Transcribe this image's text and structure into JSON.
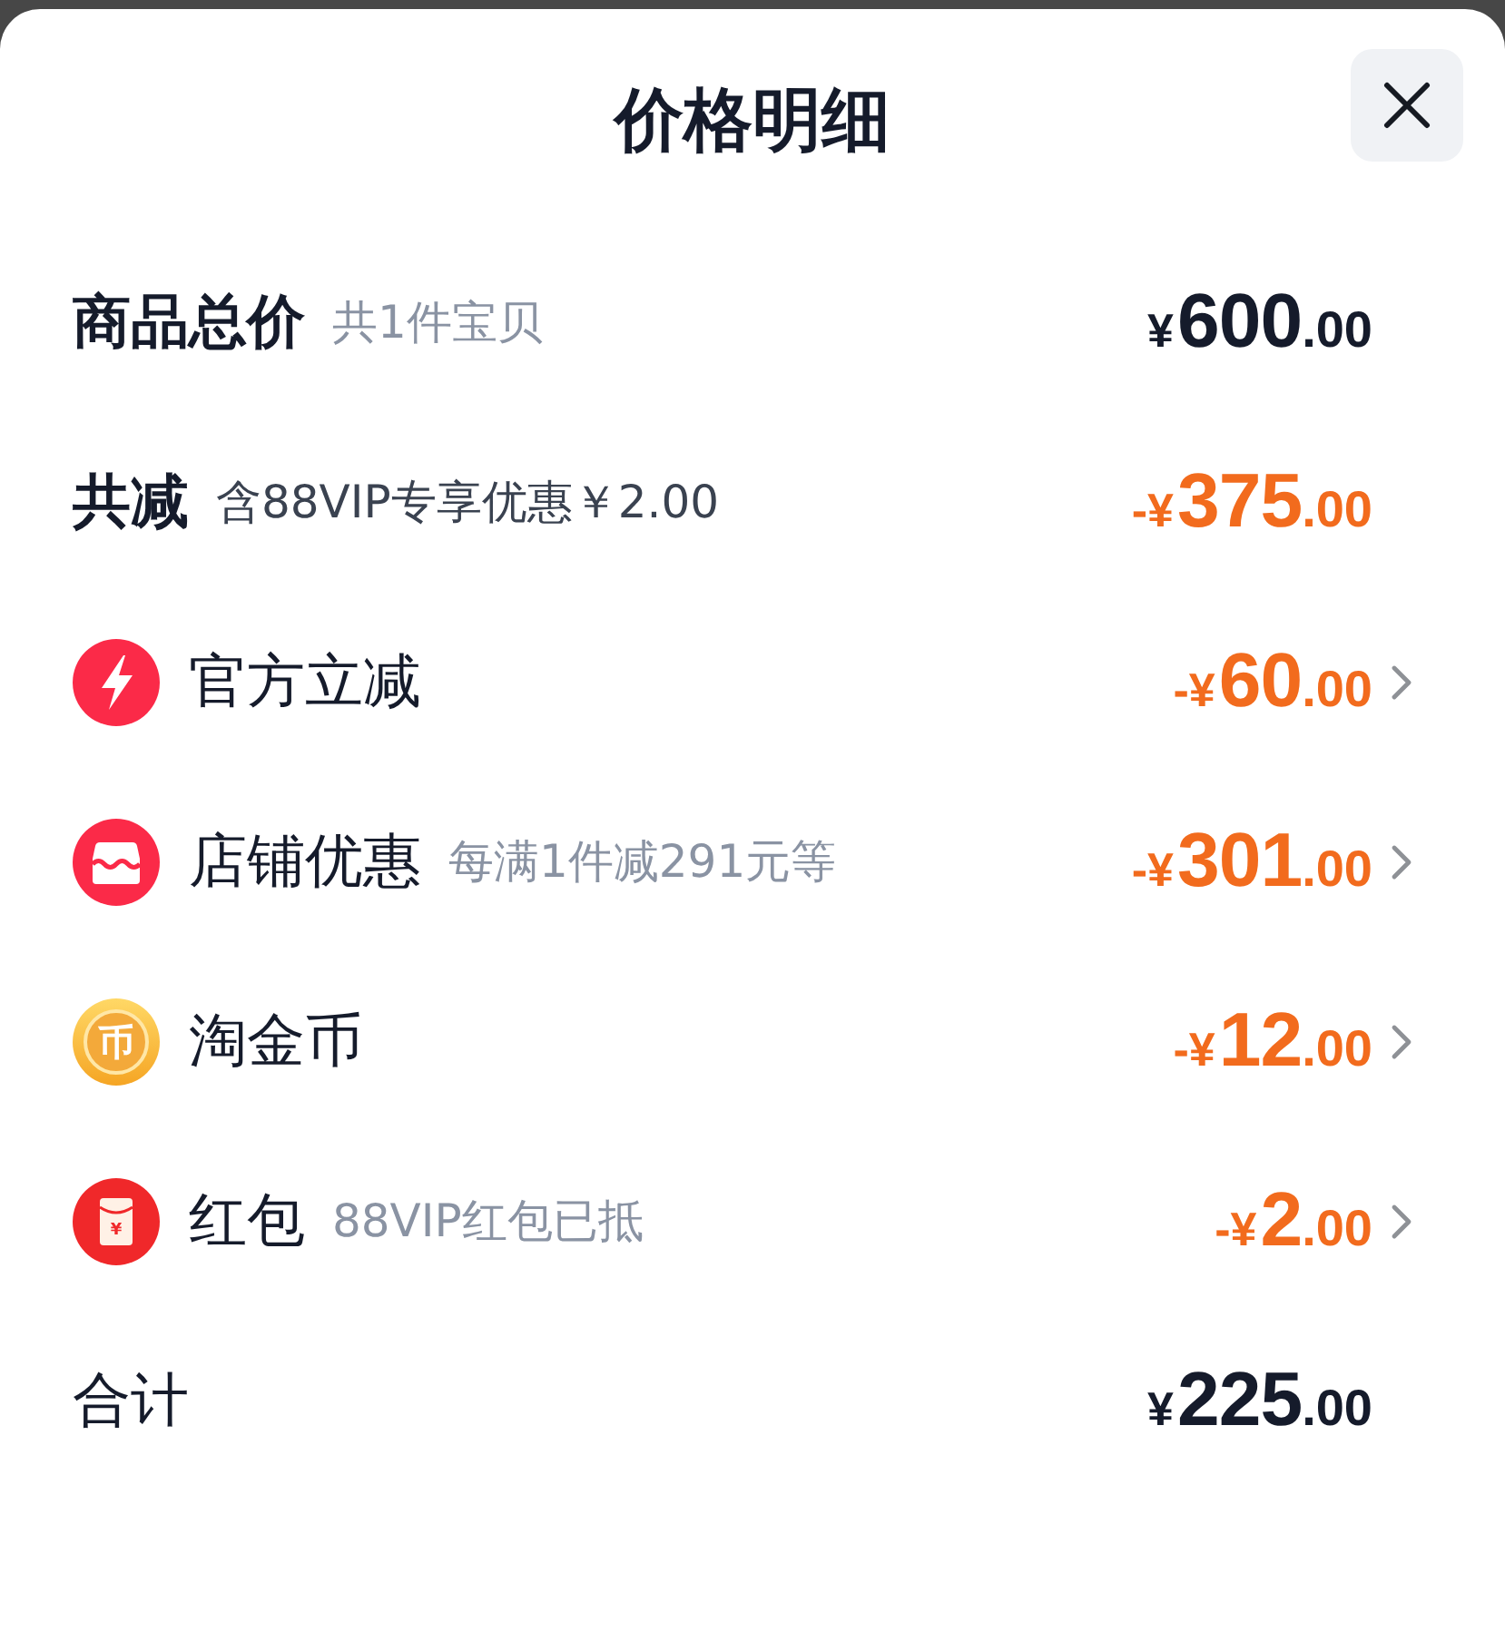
{
  "title": "价格明细",
  "rows": [
    {
      "kind": "subtotal",
      "label": "商品总价",
      "note": "共1件宝贝",
      "amount": {
        "prefix": "¥",
        "integer": "600",
        "decimals": ".00"
      }
    },
    {
      "kind": "savings",
      "label": "共减",
      "note": "含88VIP专享优惠￥2.00",
      "amount": {
        "prefix": "-¥",
        "integer": "375",
        "decimals": ".00"
      }
    },
    {
      "kind": "official_discount",
      "label": "官方立减",
      "amount": {
        "prefix": "-¥",
        "integer": "60",
        "decimals": ".00"
      }
    },
    {
      "kind": "store_discount",
      "label": "店铺优惠",
      "note": "每满1件减291元等",
      "amount": {
        "prefix": "-¥",
        "integer": "301",
        "decimals": ".00"
      }
    },
    {
      "kind": "coins",
      "icon_glyph": "币",
      "label": "淘金币",
      "amount": {
        "prefix": "-¥",
        "integer": "12",
        "decimals": ".00"
      }
    },
    {
      "kind": "red_packet",
      "icon_glyph": "¥",
      "label": "红包",
      "note": "88VIP红包已抵",
      "amount": {
        "prefix": "-¥",
        "integer": "2",
        "decimals": ".00"
      }
    },
    {
      "kind": "total",
      "label": "合计",
      "amount": {
        "prefix": "¥",
        "integer": "225",
        "decimals": ".00"
      }
    }
  ]
}
